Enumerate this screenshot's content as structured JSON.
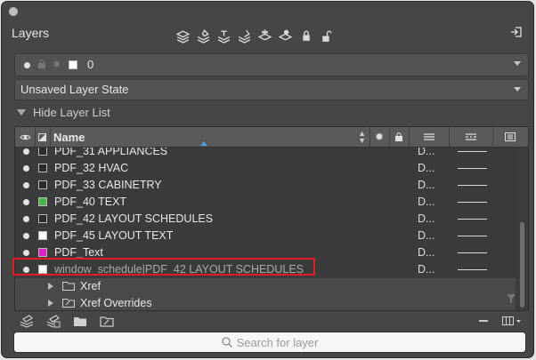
{
  "panel": {
    "title": "Layers",
    "current_layer": "0",
    "layer_state": "Unsaved Layer State",
    "hide_layer_list": "Hide Layer List"
  },
  "columns": {
    "name": "Name"
  },
  "layers": [
    {
      "name": "PDF_31 APPLIANCES",
      "d": "D...",
      "color": "#2b2b2b"
    },
    {
      "name": "PDF_32 HVAC",
      "d": "D...",
      "color": "#2b2b2b"
    },
    {
      "name": "PDF_33 CABINETRY",
      "d": "D...",
      "color": "#2b2b2b"
    },
    {
      "name": "PDF_40 TEXT",
      "d": "D...",
      "color": "#48b648"
    },
    {
      "name": "PDF_42 LAYOUT SCHEDULES",
      "d": "D...",
      "color": "#2b2b2b"
    },
    {
      "name": "PDF_45 LAYOUT TEXT",
      "d": "D...",
      "color": "#ffffff"
    },
    {
      "name": "PDF_Text",
      "d": "D...",
      "color": "#e020c8"
    },
    {
      "name": "window_schedule|PDF_42 LAYOUT SCHEDULES",
      "d": "D...",
      "color": "#ffffff"
    }
  ],
  "tree": [
    {
      "name": "Xref"
    },
    {
      "name": "Xref Overrides"
    }
  ],
  "search": {
    "placeholder": "Search for layer"
  },
  "colors": {
    "panel_bg": "#464646",
    "highlight": "#e31b23"
  }
}
